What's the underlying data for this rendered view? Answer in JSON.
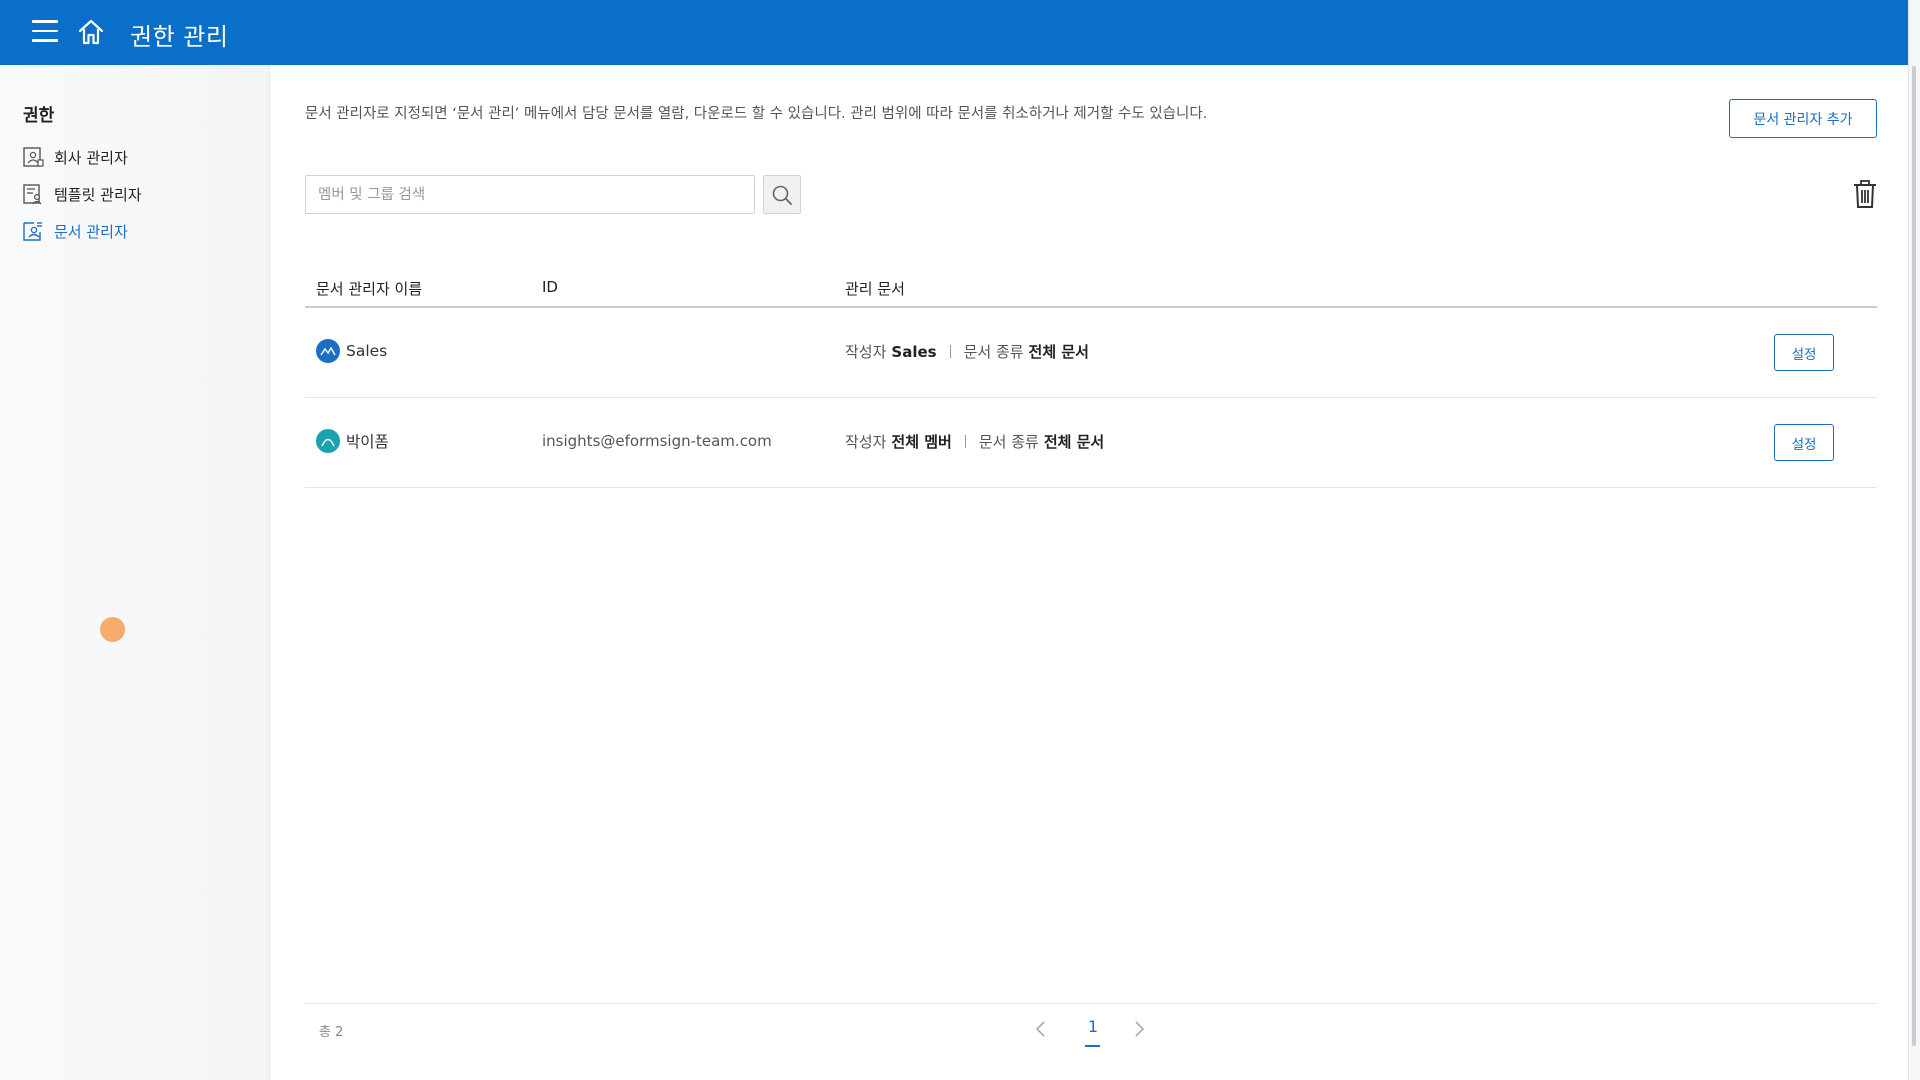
{
  "header": {
    "title": "권한 관리",
    "menu_icon": "hamburger-icon",
    "home_icon": "home-icon",
    "background_color": "#0a6fc8"
  },
  "sidebar": {
    "section_title": "권한",
    "items": [
      {
        "label": "회사 관리자",
        "icon": "company-admin-icon",
        "active": false
      },
      {
        "label": "템플릿 관리자",
        "icon": "template-admin-icon",
        "active": false
      },
      {
        "label": "문서 관리자",
        "icon": "document-admin-icon",
        "active": true
      }
    ]
  },
  "main": {
    "description": "문서 관리자로 지정되면 ‘문서 관리’ 메뉴에서 담당 문서를 열람, 다운로드 할 수 있습니다. 관리 범위에 따라 문서를 취소하거나 제거할 수도 있습니다.",
    "add_button": "문서 관리자 추가",
    "search": {
      "placeholder": "멤버 및 그룹 검색",
      "value": ""
    },
    "search_icon": "search-icon",
    "trash_icon": "trash-icon",
    "table": {
      "columns": [
        "문서 관리자 이름",
        "ID",
        "관리 문서"
      ],
      "rows": [
        {
          "name": "Sales",
          "id": "",
          "author_label": "작성자",
          "author_value": "Sales",
          "doctype_label": "문서 종류",
          "doctype_value": "전체 문서",
          "setting_label": "설정",
          "avatar_color": "#1a6fc4"
        },
        {
          "name": "박이폼",
          "id": "insights@eformsign-team.com",
          "author_label": "작성자",
          "author_value": "전체 멤버",
          "doctype_label": "문서 종류",
          "doctype_value": "전체 문서",
          "setting_label": "설정",
          "avatar_color": "#19a3b0"
        }
      ]
    },
    "footer": {
      "total": "총 2",
      "current_page": "1",
      "prev_icon": "chevron-left-icon",
      "next_icon": "chevron-right-icon"
    }
  },
  "accent_color": "#1a6fc4"
}
